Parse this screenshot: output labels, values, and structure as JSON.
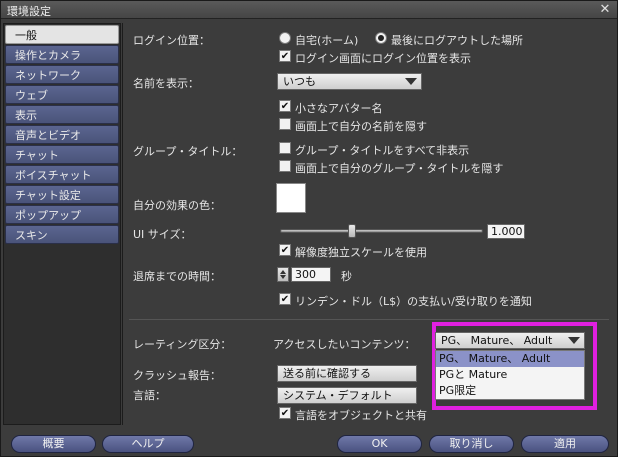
{
  "window": {
    "title": "環境設定",
    "close_glyph": "✕"
  },
  "sidebar": {
    "items": [
      {
        "label": "一般"
      },
      {
        "label": "操作とカメラ"
      },
      {
        "label": "ネットワーク"
      },
      {
        "label": "ウェブ"
      },
      {
        "label": "表示"
      },
      {
        "label": "音声とビデオ"
      },
      {
        "label": "チャット"
      },
      {
        "label": "ボイスチャット"
      },
      {
        "label": "チャット設定"
      },
      {
        "label": "ポップアップ"
      },
      {
        "label": "スキン"
      }
    ],
    "active_index": 0
  },
  "general": {
    "login_location": {
      "label": "ログイン位置：",
      "option_home": "自宅(ホーム)",
      "option_last": "最後にログアウトした場所",
      "selected": "last",
      "show_on_login_label": "ログイン画面にログイン位置を表示",
      "show_on_login_checked": true
    },
    "name_display": {
      "label": "名前を表示：",
      "value": "いつも",
      "small_avatar_label": "小さなアバター名",
      "small_avatar_checked": true,
      "hide_own_name_label": "画面上で自分の名前を隠す",
      "hide_own_name_checked": false
    },
    "group_title": {
      "label": "グループ・タイトル：",
      "hide_all_label": "グループ・タイトルをすべて非表示",
      "hide_all_checked": false,
      "hide_own_label": "画面上で自分のグループ・タイトルを隠す",
      "hide_own_checked": false
    },
    "effect_color": {
      "label": "自分の効果の色：",
      "color": "#ffffff"
    },
    "ui_size": {
      "label": "UI サイズ：",
      "value": "1.000",
      "slider_fraction": 0.36,
      "resolution_independent_label": "解像度独立スケールを使用",
      "resolution_independent_checked": true
    },
    "away_time": {
      "label": "退席までの時間：",
      "value": "300",
      "unit": "秒",
      "notify_linden_label": "リンデン・ドル（L$）の支払い/受け取りを通知",
      "notify_linden_checked": true
    },
    "maturity": {
      "label": "レーティング区分：",
      "access_label": "アクセスしたいコンテンツ：",
      "value": "PG、 Mature、 Adult",
      "options": [
        "PG、 Mature、 Adult",
        "PGと Mature",
        "PG限定"
      ],
      "selected_index": 0
    },
    "crash_report": {
      "label": "クラッシュ報告：",
      "value": "送る前に確認する"
    },
    "language": {
      "label": "言語：",
      "value": "システム・デフォルト",
      "share_label": "言語をオブジェクトと共有",
      "share_checked": true
    }
  },
  "buttons": {
    "about": "概要",
    "help": "ヘルプ",
    "ok": "OK",
    "cancel": "取り消し",
    "apply": "適用"
  },
  "check_glyph": "✔"
}
